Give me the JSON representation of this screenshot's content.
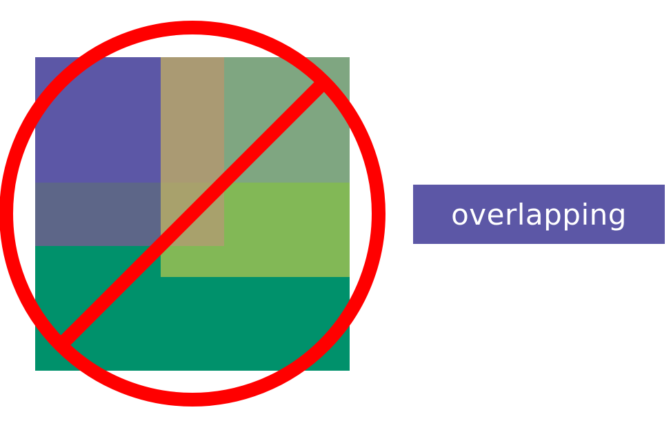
{
  "colors": {
    "background": "#ffffff",
    "purple": "#5c57a6",
    "purple_over_green": "#5d6688",
    "tan": "#aa9a73",
    "tan_over_green": "#a8a16c",
    "sage": "#7fa681",
    "light_green": "#82b856",
    "dark_green": "#00916b",
    "prohibition_red": "#ff0000",
    "label_text": "#ffffff"
  },
  "icons": {
    "prohibition": "no-symbol-icon"
  },
  "label": {
    "text": "overlapping"
  }
}
